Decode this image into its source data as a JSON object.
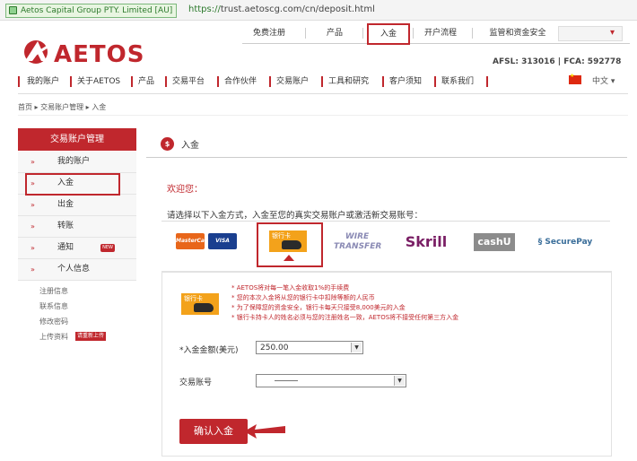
{
  "browser": {
    "cert_label": "Aetos Capital Group PTY. Limited [AU]",
    "url_proto": "https://",
    "url_rest": "trust.aetoscg.com/cn/deposit.html"
  },
  "top_nav": {
    "items": [
      "免费注册",
      "产品",
      "入金",
      "开户流程",
      "监管和资金安全"
    ],
    "selected": "入金",
    "account_dropdown_icon": "chevron-down-icon"
  },
  "brand": {
    "name": "AETOS",
    "license": "AFSL: 313016  |  FCA: 592778",
    "accent_color": "#c0272d"
  },
  "main_nav": {
    "items": [
      "我的账户",
      "关于AETOS",
      "产品",
      "交易平台",
      "合作伙伴",
      "交易账户",
      "工具和研究",
      "客户须知",
      "联系我们"
    ],
    "language": "中文"
  },
  "breadcrumb": "首页 ▸ 交易账户管理 ▸ 入金",
  "sidebar": {
    "title": "交易账户管理",
    "items": [
      {
        "label": "我的账户"
      },
      {
        "label": "入金"
      },
      {
        "label": "出金"
      },
      {
        "label": "转账"
      },
      {
        "label": "通知"
      },
      {
        "label": "个人信息"
      }
    ],
    "selected": "入金",
    "notice_badge": "NEW",
    "sub_items": [
      "注册信息",
      "联系信息",
      "修改密码",
      "上传资料"
    ],
    "upload_button": "请重新上传"
  },
  "content": {
    "header_icon": "$",
    "header_title": "入金",
    "welcome": "欢迎您：",
    "instruction": "请选择以下入金方式，入金至您的真实交易账户或激活新交易账号：",
    "payment_methods": [
      {
        "name": "MasterCard"
      },
      {
        "name": "VISA"
      },
      {
        "name": "银行卡",
        "selected": true
      },
      {
        "name": "WIRE TRANSFER"
      },
      {
        "name": "Skrill"
      },
      {
        "name": "cashU"
      },
      {
        "name": "SecurePay"
      }
    ],
    "bank_card_label": "银行卡",
    "notes": [
      "* AETOS将对每一笔入金收取1%的手续费",
      "* 您的本次入金将从您的银行卡中扣除等额的人民币",
      "* 为了保障您的资金安全，银行卡每天只接受8,000美元的入金",
      "* 银行卡持卡人的姓名必须与您的注册姓名一致，AETOS将不接受任何第三方入金"
    ],
    "amount_label": "*入金金额(美元)",
    "amount_value": "250.00",
    "account_label": "交易账号",
    "confirm_button": "确认入金"
  }
}
